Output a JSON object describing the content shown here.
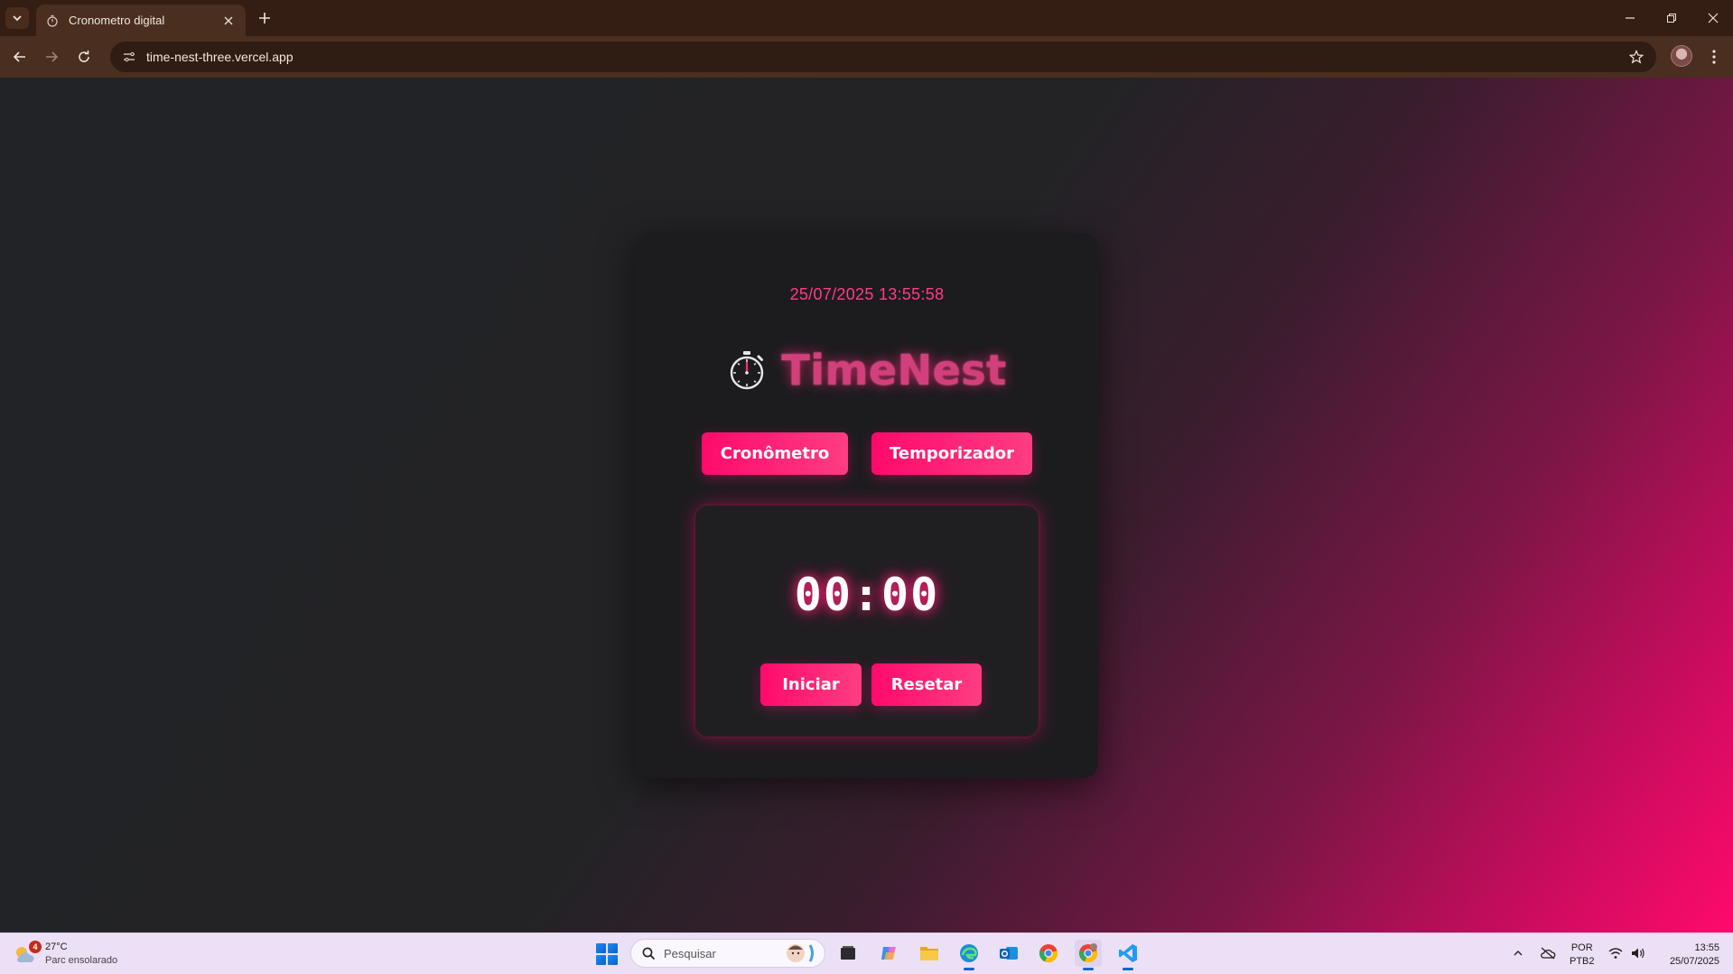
{
  "browser": {
    "tab": {
      "title": "Cronometro digital",
      "favicon": "stopwatch-icon"
    },
    "url": "time-nest-three.vercel.app",
    "icons": [
      "tab-list-icon",
      "close-icon",
      "plus-icon",
      "minimize-icon",
      "restore-icon",
      "window-close-icon",
      "back-icon",
      "forward-icon",
      "reload-icon",
      "site-info-icon",
      "star-icon",
      "profile-avatar",
      "more-menu-icon"
    ]
  },
  "app": {
    "datetime": "25/07/2025 13:55:58",
    "brand": {
      "icon": "stopwatch-icon",
      "title": "TimeNest"
    },
    "modes": {
      "stopwatch": "Cronômetro",
      "timer": "Temporizador"
    },
    "display": "00:00",
    "controls": {
      "start": "Iniciar",
      "reset": "Resetar"
    },
    "colors": {
      "accent": "#ff0a6c",
      "accent_light": "#ff3d82",
      "card_bg": "#1c1c1f",
      "page_bg": "#222326",
      "datetime": "#ff3c86"
    }
  },
  "taskbar": {
    "weather": {
      "temp": "27°C",
      "desc": "Parc ensolarado",
      "badge": "4"
    },
    "search": {
      "placeholder": "Pesquisar"
    },
    "apps": [
      "task-view-icon",
      "copilot-icon",
      "file-explorer-icon",
      "edge-icon",
      "outlook-icon",
      "chrome-icon",
      "chrome-profile-icon",
      "vscode-icon"
    ],
    "tray": {
      "lang": "POR",
      "layout": "PTB2",
      "time": "13:55",
      "date": "25/07/2025"
    }
  }
}
